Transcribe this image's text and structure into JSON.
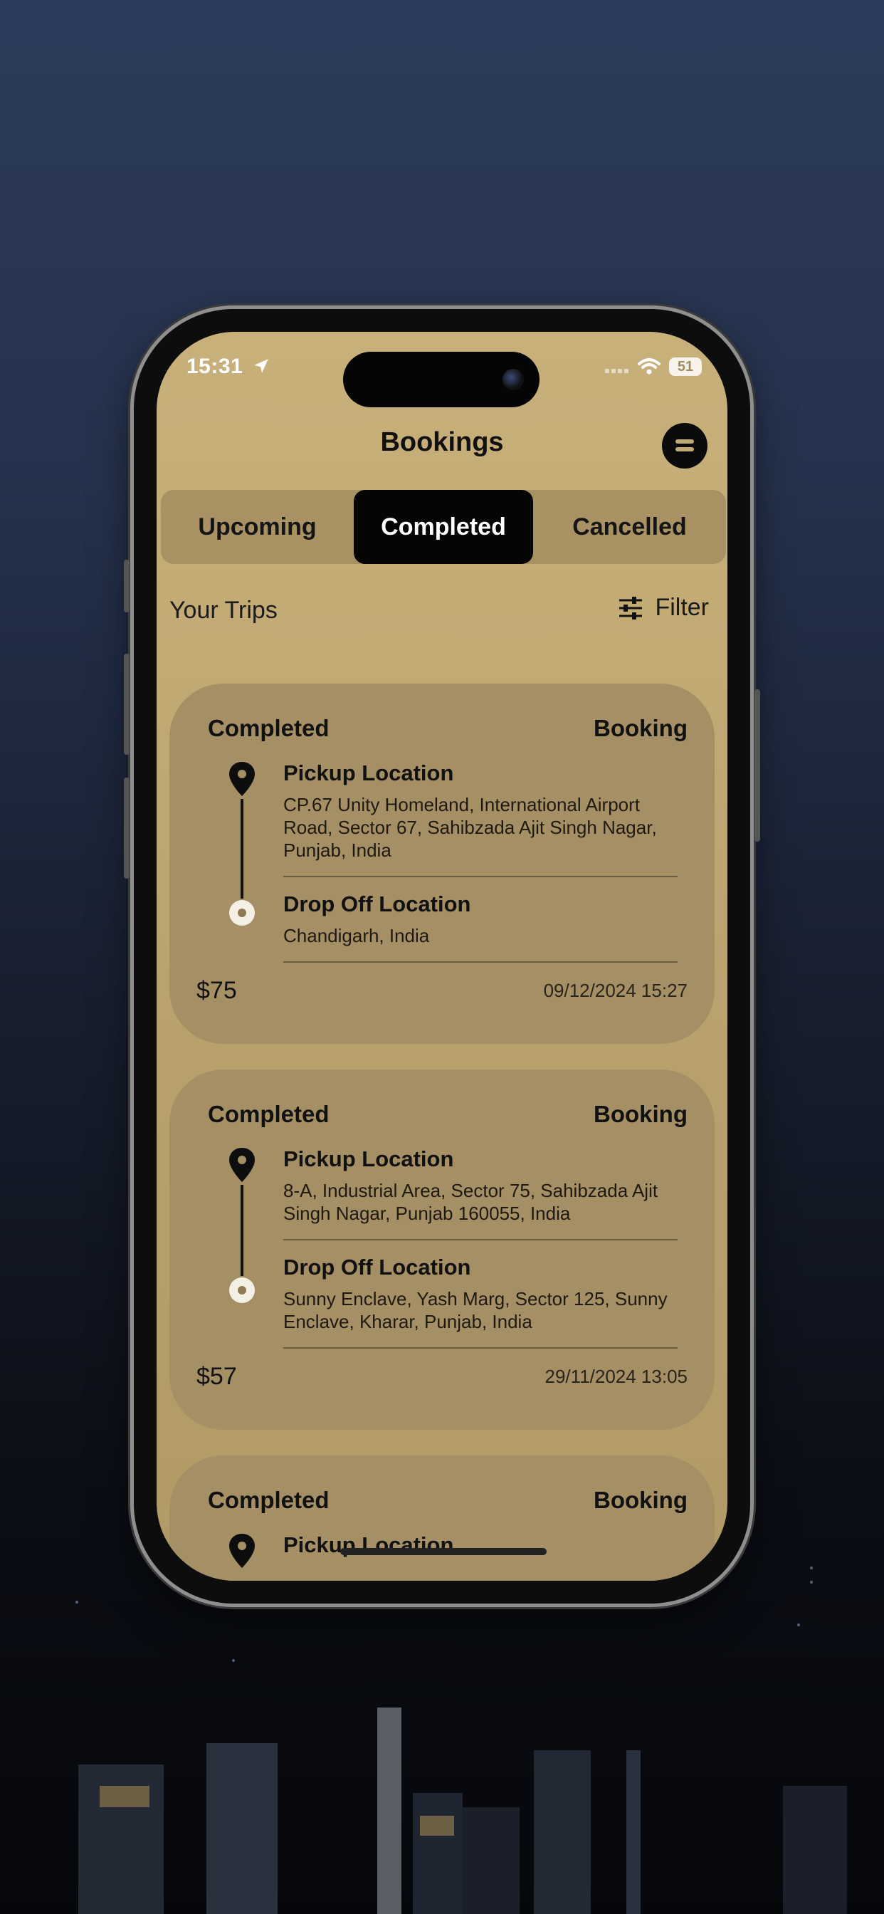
{
  "status_bar": {
    "time": "15:31",
    "battery": "51"
  },
  "header": {
    "title": "Bookings"
  },
  "tabs": [
    {
      "label": "Upcoming",
      "active": false
    },
    {
      "label": "Completed",
      "active": true
    },
    {
      "label": "Cancelled",
      "active": false
    }
  ],
  "trips": {
    "title": "Your Trips",
    "filter_label": "Filter"
  },
  "bookings": [
    {
      "status": "Completed",
      "type": "Booking",
      "pickup_title": "Pickup Location",
      "pickup_address": "CP.67 Unity Homeland, International Airport Road, Sector 67, Sahibzada Ajit Singh Nagar, Punjab, India",
      "drop_title": "Drop Off Location",
      "drop_address": "Chandigarh, India",
      "price": "$75",
      "datetime": "09/12/2024 15:27"
    },
    {
      "status": "Completed",
      "type": "Booking",
      "pickup_title": "Pickup Location",
      "pickup_address": "8-A, Industrial Area, Sector 75, Sahibzada Ajit Singh Nagar, Punjab 160055, India",
      "drop_title": "Drop Off Location",
      "drop_address": "Sunny Enclave, Yash Marg, Sector 125, Sunny Enclave, Kharar, Punjab, India",
      "price": "$57",
      "datetime": "29/11/2024 13:05"
    },
    {
      "status": "Completed",
      "type": "Booking",
      "pickup_title": "Pickup Location"
    }
  ],
  "icons": {
    "menu": "menu-icon",
    "filter": "sliders-icon",
    "pickup": "map-pin-icon",
    "drop": "target-dot-icon",
    "location_arrow": "location-arrow-icon",
    "wifi": "wifi-icon",
    "signal": "cellular-signal-icon"
  },
  "colors": {
    "screen_bg": "#c1a974",
    "card_bg": "#a58f64",
    "tab_bar_bg": "#a89264",
    "active_tab_bg": "#050505"
  }
}
